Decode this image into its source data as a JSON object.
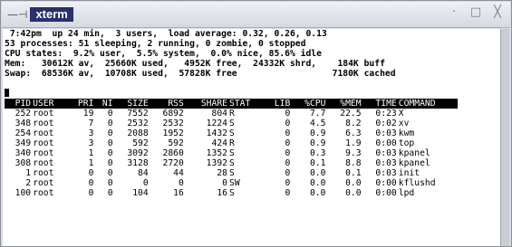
{
  "window": {
    "title": "xterm",
    "menu_glyph": "—⊣",
    "buttons": [
      "·",
      "□",
      "╳"
    ]
  },
  "top": {
    "summary_lines": [
      " 7:42pm  up 24 min,  3 users,  load average: 0.32, 0.26, 0.13",
      "53 processes: 51 sleeping, 2 running, 0 zombie, 0 stopped",
      "CPU states:  9.2% user,  5.5% system,  0.0% nice, 85.6% idle",
      "Mem:   30612K av,  25660K used,   4952K free,  24332K shrd,    184K buff",
      "Swap:  68536K av,  10708K used,  57828K free                  7180K cached"
    ],
    "columns": [
      "PID",
      "USER",
      "PRI",
      "NI",
      "SIZE",
      "RSS",
      "SHARE",
      "STAT",
      "LIB",
      "%CPU",
      "%MEM",
      "TIME",
      "COMMAND"
    ],
    "rows": [
      [
        "252",
        "root",
        "19",
        "0",
        "7552",
        "6892",
        "804",
        "R",
        "0",
        "7.7",
        "22.5",
        "0:23",
        "X"
      ],
      [
        "348",
        "root",
        "7",
        "0",
        "2532",
        "2532",
        "1224",
        "S",
        "0",
        "4.5",
        "8.2",
        "0:02",
        "xv"
      ],
      [
        "254",
        "root",
        "3",
        "0",
        "2088",
        "1952",
        "1432",
        "S",
        "0",
        "0.9",
        "6.3",
        "0:03",
        "kwm"
      ],
      [
        "349",
        "root",
        "3",
        "0",
        "592",
        "592",
        "424",
        "R",
        "0",
        "0.9",
        "1.9",
        "0:00",
        "top"
      ],
      [
        "340",
        "root",
        "1",
        "0",
        "3092",
        "2860",
        "1352",
        "S",
        "0",
        "0.3",
        "9.3",
        "0:03",
        "kpanel"
      ],
      [
        "308",
        "root",
        "1",
        "0",
        "3128",
        "2720",
        "1392",
        "S",
        "0",
        "0.1",
        "8.8",
        "0:03",
        "kpanel"
      ],
      [
        "1",
        "root",
        "0",
        "0",
        "84",
        "44",
        "28",
        "S",
        "0",
        "0.0",
        "0.1",
        "0:03",
        "init"
      ],
      [
        "2",
        "root",
        "0",
        "0",
        "0",
        "0",
        "0",
        "SW",
        "0",
        "0.0",
        "0.0",
        "0:00",
        "kflushd"
      ],
      [
        "100",
        "root",
        "0",
        "0",
        "104",
        "16",
        "16",
        "S",
        "0",
        "0.0",
        "0.0",
        "0:00",
        "lpd"
      ]
    ]
  }
}
